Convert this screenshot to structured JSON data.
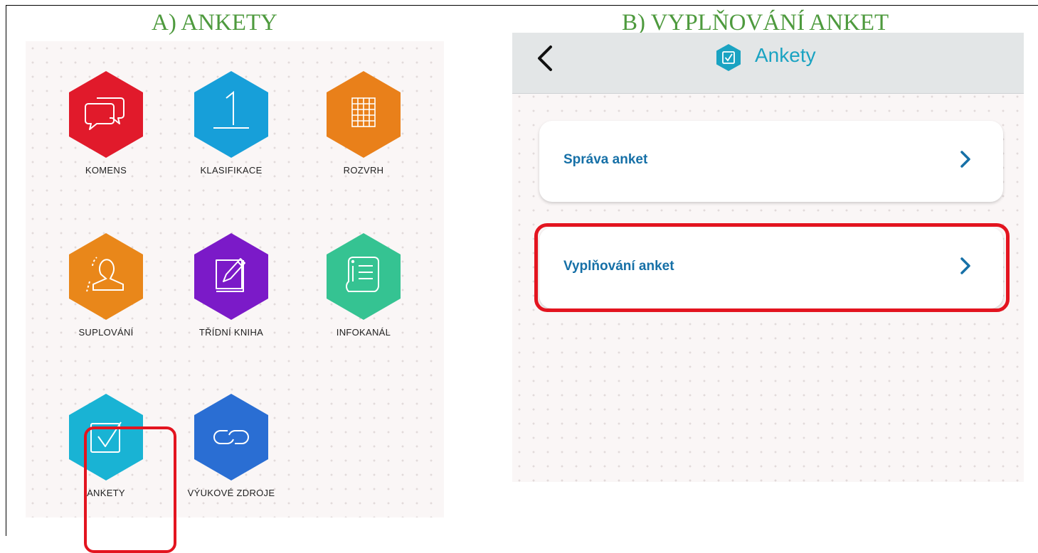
{
  "captions": {
    "a": "A) ANKETY",
    "b": "B) VYPLŇOVÁNÍ ANKET"
  },
  "panel_a": {
    "tiles": [
      {
        "label": "KOMENS",
        "color": "#e11a2b",
        "icon": "chat-bubbles-icon"
      },
      {
        "label": "KLASIFIKACE",
        "color": "#179fd9",
        "icon": "number-one-icon"
      },
      {
        "label": "ROZVRH",
        "color": "#e9801a",
        "icon": "timetable-grid-icon"
      },
      {
        "label": "SUPLOVÁNÍ",
        "color": "#e9871a",
        "icon": "person-substitute-icon"
      },
      {
        "label": "TŘÍDNÍ KNIHA",
        "color": "#7b1ac8",
        "icon": "pencil-book-icon"
      },
      {
        "label": "INFOKANÁL",
        "color": "#35c392",
        "icon": "info-list-icon"
      },
      {
        "label": "ANKETY",
        "color": "#19b3d4",
        "icon": "checkbox-icon"
      },
      {
        "label": "VÝUKOVÉ ZDROJE",
        "color": "#2a6ed3",
        "icon": "link-icon"
      }
    ],
    "highlight_color": "#e3141f"
  },
  "panel_b": {
    "title": "Ankety",
    "accent": "#1aa3c2",
    "items": [
      {
        "label": "Správa anket"
      },
      {
        "label": "Vyplňování anket"
      }
    ]
  }
}
